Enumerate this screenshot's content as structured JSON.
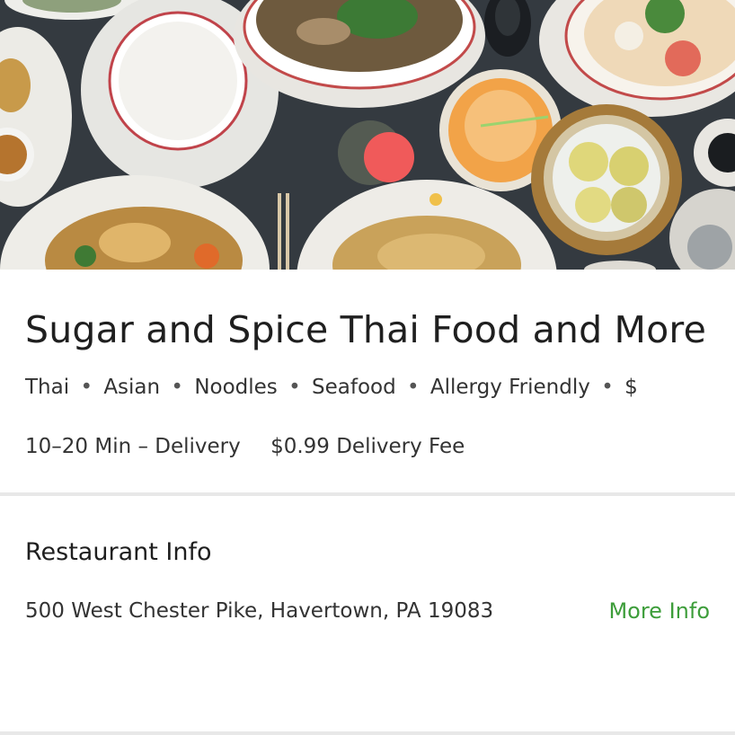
{
  "restaurant": {
    "name": "Sugar and Spice Thai Food and More",
    "tags": [
      "Thai",
      "Asian",
      "Noodles",
      "Seafood",
      "Allergy Friendly",
      "$"
    ],
    "tag_separator": "•",
    "delivery_time": "10–20 Min – Delivery",
    "delivery_fee": "$0.99 Delivery Fee"
  },
  "info": {
    "heading": "Restaurant Info",
    "address": "500 West Chester Pike, Havertown, PA 19083",
    "more_info_label": "More Info"
  },
  "colors": {
    "accent": "#3d9d3a",
    "table": "#33393f"
  }
}
